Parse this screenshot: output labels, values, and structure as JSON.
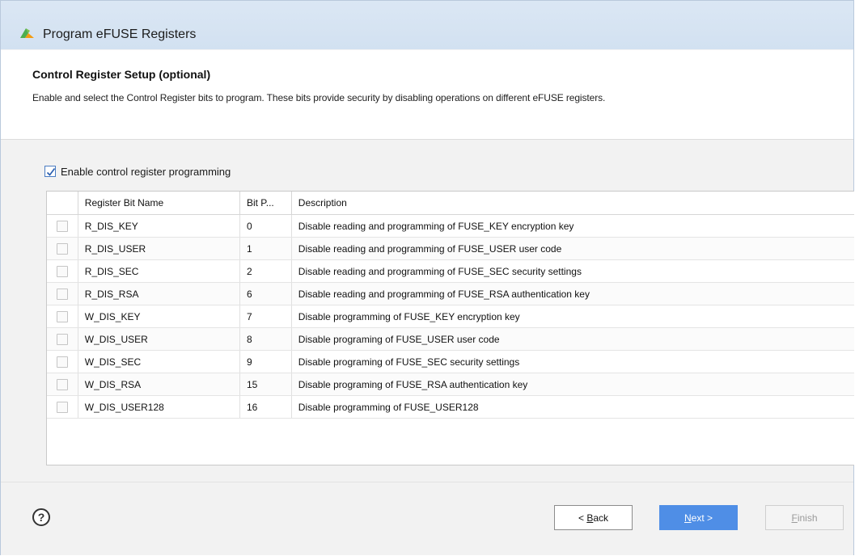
{
  "window": {
    "title": "Program eFUSE Registers"
  },
  "header": {
    "title": "Control Register Setup (optional)",
    "description": "Enable and select the Control Register bits to program. These bits provide security by disabling operations on different eFUSE registers."
  },
  "enable": {
    "label": "Enable control register programming",
    "checked": true
  },
  "table": {
    "columns": [
      "",
      "Register Bit Name",
      "Bit P...",
      "Description"
    ],
    "rows": [
      {
        "checked": false,
        "name": "R_DIS_KEY",
        "bit": "0",
        "desc": "Disable reading and programming of FUSE_KEY encryption key"
      },
      {
        "checked": false,
        "name": "R_DIS_USER",
        "bit": "1",
        "desc": "Disable reading and programming of FUSE_USER user code"
      },
      {
        "checked": false,
        "name": "R_DIS_SEC",
        "bit": "2",
        "desc": "Disable reading and programming of FUSE_SEC security settings"
      },
      {
        "checked": false,
        "name": "R_DIS_RSA",
        "bit": "6",
        "desc": "Disable reading and programming of FUSE_RSA authentication key"
      },
      {
        "checked": false,
        "name": "W_DIS_KEY",
        "bit": "7",
        "desc": "Disable programming of FUSE_KEY encryption key"
      },
      {
        "checked": false,
        "name": "W_DIS_USER",
        "bit": "8",
        "desc": "Disable programing of FUSE_USER user code"
      },
      {
        "checked": false,
        "name": "W_DIS_SEC",
        "bit": "9",
        "desc": "Disable programing of FUSE_SEC security settings"
      },
      {
        "checked": false,
        "name": "W_DIS_RSA",
        "bit": "15",
        "desc": "Disable programing of FUSE_RSA authentication key"
      },
      {
        "checked": false,
        "name": "W_DIS_USER128",
        "bit": "16",
        "desc": "Disable programming of FUSE_USER128"
      }
    ]
  },
  "footer": {
    "help_icon": "help-icon",
    "help_glyph": "?",
    "back": {
      "prefix": "< ",
      "mnemonic": "B",
      "rest": "ack"
    },
    "next": {
      "mnemonic": "N",
      "rest": "ext >"
    },
    "finish": {
      "mnemonic": "F",
      "rest": "inish"
    }
  },
  "colors": {
    "accent": "#4f8ee6",
    "titlebar": "#d7e4f3"
  }
}
